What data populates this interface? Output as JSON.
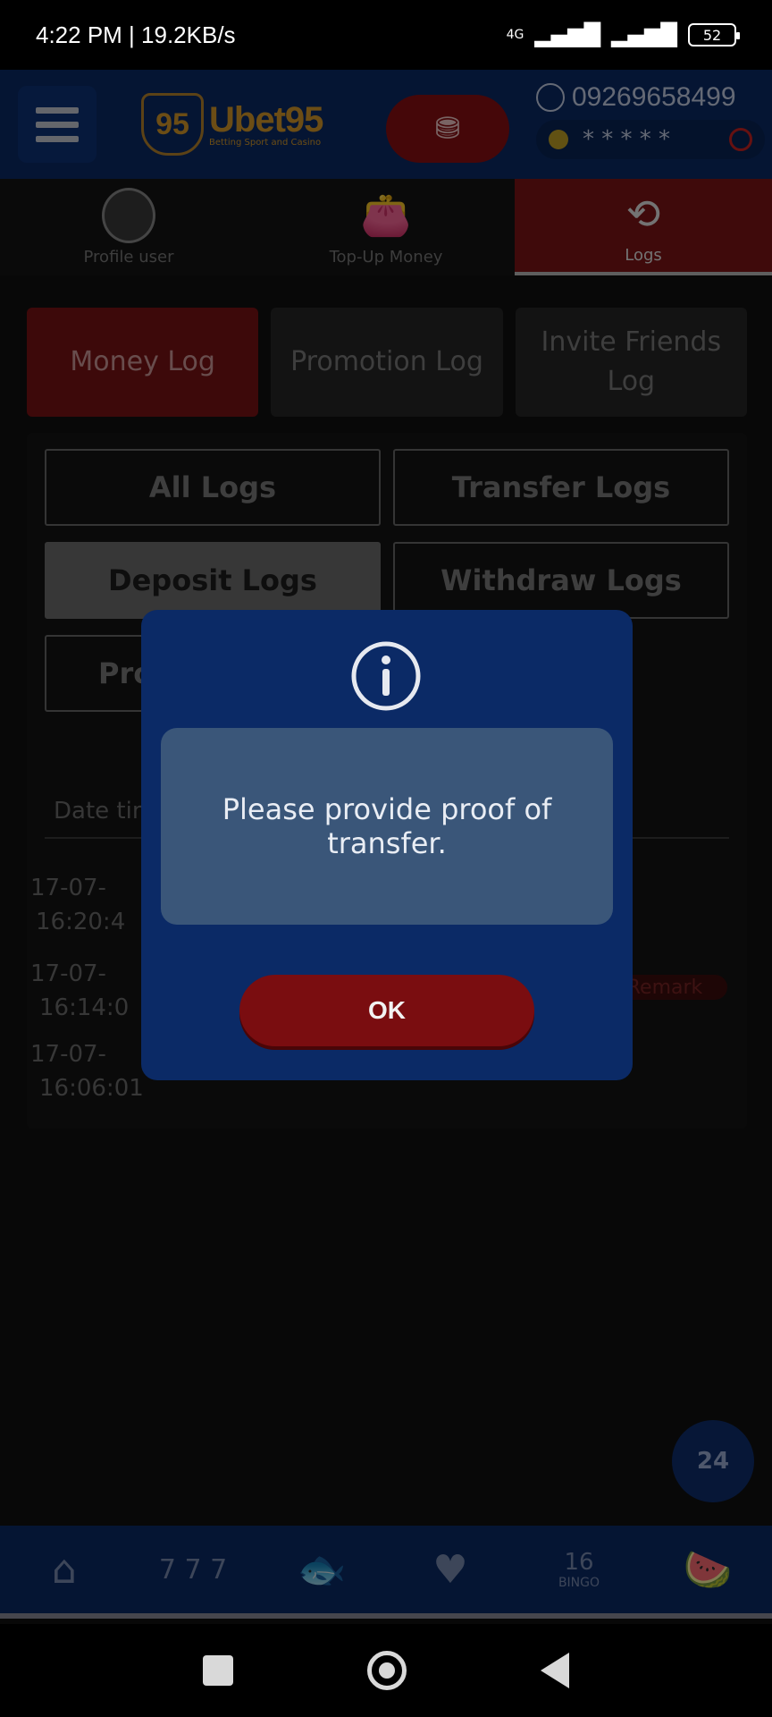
{
  "status_bar": {
    "time": "4:22 PM | 19.2KB/s",
    "network": "4G",
    "battery": "52"
  },
  "header": {
    "logo_badge": "95",
    "logo_name": "Ubet95",
    "logo_tagline": "Betting Sport and Casino",
    "phone": "09269658499",
    "balance_masked": "* * * * *"
  },
  "top_tabs": [
    {
      "label": "Profile user",
      "icon": "user-icon"
    },
    {
      "label": "Top-Up Money",
      "icon": "wallet-icon"
    },
    {
      "label": "Logs",
      "icon": "history-icon",
      "active": true
    }
  ],
  "log_tabs": [
    {
      "label": "Money Log",
      "active": true
    },
    {
      "label": "Promotion Log"
    },
    {
      "label": "Invite Friends Log"
    }
  ],
  "filters": {
    "all": "All Logs",
    "transfer": "Transfer Logs",
    "deposit": "Deposit Logs",
    "withdraw": "Withdraw Logs",
    "promo_partial": "Pro"
  },
  "table": {
    "header_partial": "Date tim",
    "rows": [
      {
        "date": "17-07-",
        "time": "16:20:4"
      },
      {
        "date": "17-07-",
        "time": "16:14:0"
      },
      {
        "date": "17-07-",
        "time": "16:06:01"
      }
    ],
    "remark": "Remark"
  },
  "support": "24",
  "game_nav": {
    "bingo_label": "BINGO",
    "bingo_ball": "16"
  },
  "dialog": {
    "message": "Please provide proof of transfer.",
    "ok": "OK",
    "icon": "info-icon"
  },
  "colors": {
    "header_blue": "#0b2a66",
    "accent_red": "#7a0d10",
    "dialog_msg_bg": "#3a5679"
  }
}
